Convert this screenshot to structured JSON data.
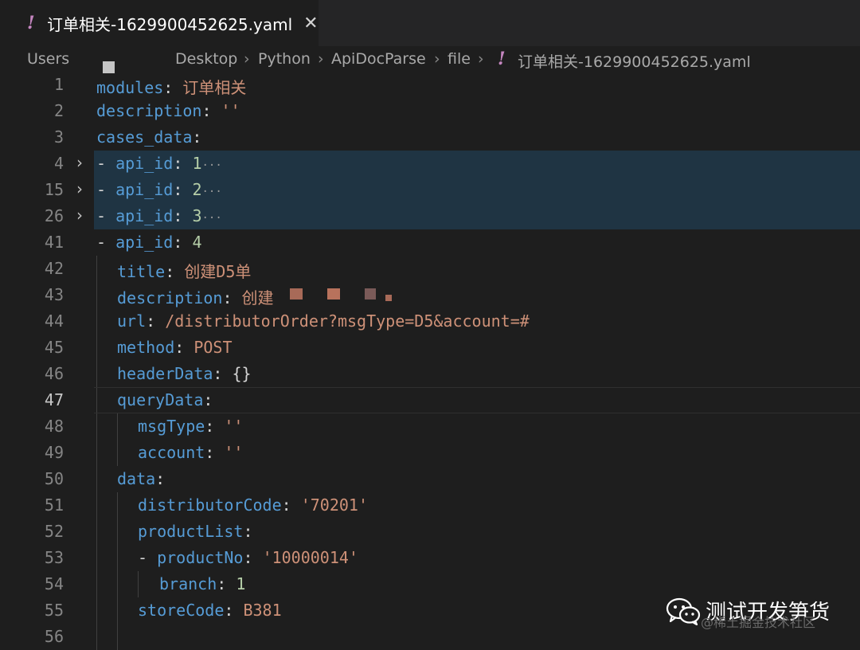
{
  "tab": {
    "icon": "exclamation-icon",
    "title": "订单相关-1629900452625.yaml",
    "close": "✕"
  },
  "breadcrumb": {
    "users": "Users",
    "desktop": "Desktop",
    "python": "Python",
    "apidocparse": "ApiDocParse",
    "file": "file",
    "filename": "订单相关-1629900452625.yaml",
    "separator": "›"
  },
  "lines": [
    {
      "num": "1"
    },
    {
      "num": "2"
    },
    {
      "num": "3"
    },
    {
      "num": "4"
    },
    {
      "num": "15"
    },
    {
      "num": "26"
    },
    {
      "num": "41"
    },
    {
      "num": "42"
    },
    {
      "num": "43"
    },
    {
      "num": "44"
    },
    {
      "num": "45"
    },
    {
      "num": "46"
    },
    {
      "num": "47"
    },
    {
      "num": "48"
    },
    {
      "num": "49"
    },
    {
      "num": "50"
    },
    {
      "num": "51"
    },
    {
      "num": "52"
    },
    {
      "num": "53"
    },
    {
      "num": "54"
    },
    {
      "num": "55"
    },
    {
      "num": "56"
    }
  ],
  "code": {
    "l1": {
      "key": "modules",
      "val": "订单相关"
    },
    "l2": {
      "key": "description",
      "val": "''"
    },
    "l3": {
      "key": "cases_data"
    },
    "l4": {
      "dash": "-",
      "key": "api_id",
      "val": "1",
      "dots": "···"
    },
    "l15": {
      "dash": "-",
      "key": "api_id",
      "val": "2",
      "dots": "···"
    },
    "l26": {
      "dash": "-",
      "key": "api_id",
      "val": "3",
      "dots": "···"
    },
    "l41": {
      "dash": "-",
      "key": "api_id",
      "val": "4"
    },
    "l42": {
      "key": "title",
      "val": "创建D5单"
    },
    "l43": {
      "key": "description",
      "val": "创建"
    },
    "l44": {
      "key": "url",
      "val": "/distributorOrder?msgType=D5&account=#"
    },
    "l45": {
      "key": "method",
      "val": "POST"
    },
    "l46": {
      "key": "headerData",
      "val": "{}"
    },
    "l47": {
      "key": "queryData"
    },
    "l48": {
      "key": "msgType",
      "val": "''"
    },
    "l49": {
      "key": "account",
      "val": "''"
    },
    "l50": {
      "key": "data"
    },
    "l51": {
      "key": "distributorCode",
      "val": "'70201'"
    },
    "l52": {
      "key": "productList"
    },
    "l53": {
      "dash": "-",
      "key": "productNo",
      "val": "'10000014'"
    },
    "l54": {
      "key": "branch",
      "val": "1"
    },
    "l55": {
      "key": "storeCode",
      "val": "B381"
    }
  },
  "watermark": {
    "icon": "wechat-icon",
    "title": "测试开发笋货",
    "sub": "@稀土掘金技术社区"
  },
  "colors": {
    "key": "#569cd6",
    "string": "#ce9178",
    "number": "#b5cea8",
    "fold_highlight": "#1f3443",
    "tab_icon": "#c586c0"
  }
}
